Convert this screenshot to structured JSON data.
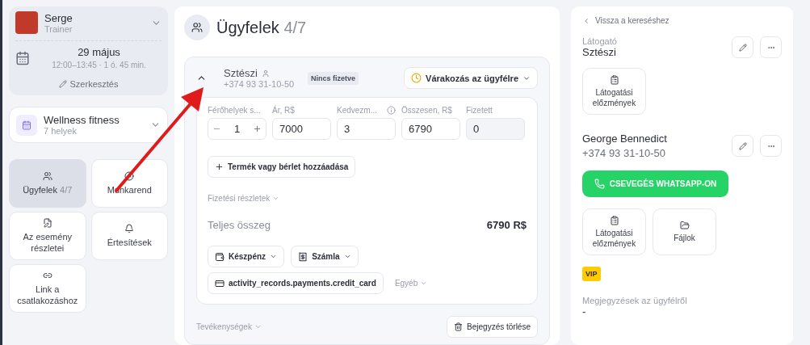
{
  "profile": {
    "name": "Serge",
    "role": "Trainer",
    "date": "29 május",
    "time": "12:00–13:45 · 1 ó. 45 min.",
    "edit": "Szerkesztés"
  },
  "location": {
    "title": "Wellness fitness",
    "subtitle": "7 helyek"
  },
  "nav": [
    {
      "kind": "clients",
      "label": "Ügyfelek",
      "count": "4/7",
      "selected": true
    },
    {
      "kind": "schedule",
      "label": "Munkarend",
      "selected": false
    },
    {
      "kind": "details",
      "label": "Az esemény részletei",
      "selected": false
    },
    {
      "kind": "notifications",
      "label": "Értesítések",
      "selected": false
    },
    {
      "kind": "link",
      "label": "Link a csatlakozáshoz",
      "selected": false
    }
  ],
  "main": {
    "title": "Ügyfelek",
    "count": "4/7"
  },
  "client": {
    "name": "Sztészi",
    "phone": "+374 93 31-10-50",
    "expanded": true,
    "badge": "Nincs fizetve",
    "status": "Várakozás az ügyfélre"
  },
  "fields": [
    {
      "kind": "stepper",
      "label": "Férőhelyek s...",
      "value": "1"
    },
    {
      "kind": "input",
      "label": "Ár, R$",
      "value": "7000"
    },
    {
      "kind": "input",
      "label": "Kedvezm...",
      "value": "3",
      "info": true
    },
    {
      "kind": "input",
      "label": "Összesen, R$",
      "value": "6790"
    },
    {
      "kind": "input",
      "label": "Fizetett",
      "value": "0",
      "disabled": true
    }
  ],
  "add_button": "Termék vagy bérlet hozzáadása",
  "payment_details": "Fizetési részletek",
  "total": {
    "label": "Teljes összeg",
    "value": "6790 R$"
  },
  "payment_methods": [
    {
      "kind": "cash",
      "label": "Készpénz"
    },
    {
      "kind": "invoice",
      "label": "Számla"
    },
    {
      "kind": "card",
      "label": "activity_records.payments.credit_card"
    }
  ],
  "other": "Egyéb",
  "activities": "Tevékenységek",
  "delete_button": "Bejegyzés törlése",
  "side": {
    "back": "Vissza a kereséshez",
    "visitor_label": "Látogató",
    "visitor_name": "Sztészi",
    "visitor_actions": [
      {
        "kind": "history",
        "label": "Látogatási előzmények"
      }
    ],
    "contact_name": "George Bennedict",
    "contact_phone": "+374 93 31-10-50",
    "whatsapp": "CSEVEGÉS WHATSAPP-ON",
    "contact_actions": [
      {
        "kind": "history",
        "label": "Látogatási előzmények"
      },
      {
        "kind": "files",
        "label": "Fájlok"
      }
    ],
    "tag": "VIP",
    "notes_label": "Megjegyzések az ügyfélről",
    "notes_value": "-"
  }
}
